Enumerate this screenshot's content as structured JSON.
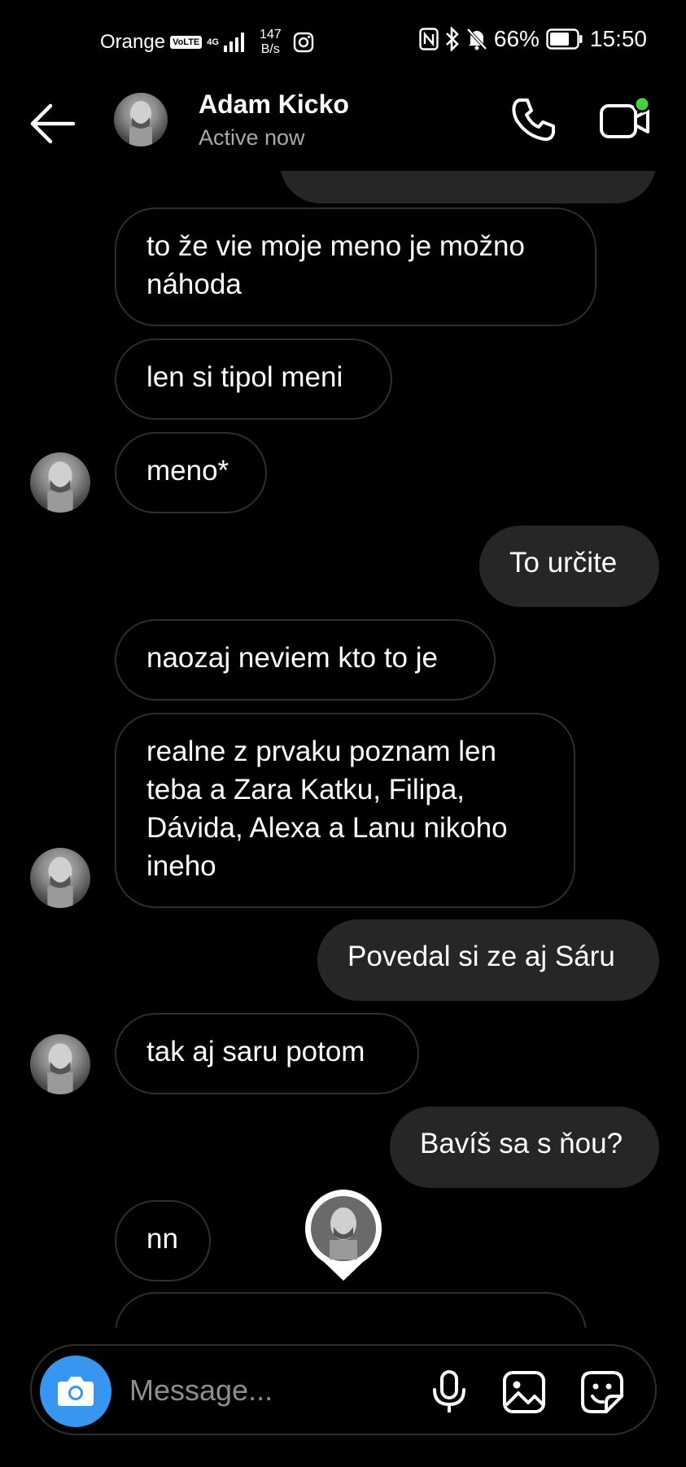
{
  "status_bar": {
    "carrier": "Orange",
    "volte": "VoLTE",
    "network": "4G",
    "speed_value": "147",
    "speed_unit": "B/s",
    "battery": "66%",
    "time": "15:50"
  },
  "header": {
    "name": "Adam Kicko",
    "status": "Active now"
  },
  "messages": [
    {
      "side": "received",
      "text": "to že vie moje meno je možno náhoda"
    },
    {
      "side": "received",
      "text": "len si tipol meni"
    },
    {
      "side": "received",
      "text": "meno*"
    },
    {
      "side": "sent",
      "text": "To určite"
    },
    {
      "side": "received",
      "text": "naozaj neviem kto to je"
    },
    {
      "side": "received",
      "text": "realne z prvaku poznam len teba a  Zara Katku, Filipa, Dávida, Alexa a Lanu nikoho ineho"
    },
    {
      "side": "sent",
      "text": "Povedal si ze aj Sáru"
    },
    {
      "side": "received",
      "text": "tak aj saru potom"
    },
    {
      "side": "sent",
      "text": "Bavíš sa s ňou?"
    },
    {
      "side": "received",
      "text": "nn"
    }
  ],
  "composer": {
    "placeholder": "Message..."
  },
  "colors": {
    "background": "#000000",
    "sent_bubble": "#262626",
    "received_border": "#2e2e2e",
    "accent_blue": "#3797f0",
    "online_dot": "#44d13b"
  },
  "icons": [
    "back-arrow-icon",
    "phone-icon",
    "video-call-icon",
    "camera-icon",
    "microphone-icon",
    "gallery-icon",
    "sticker-icon"
  ]
}
